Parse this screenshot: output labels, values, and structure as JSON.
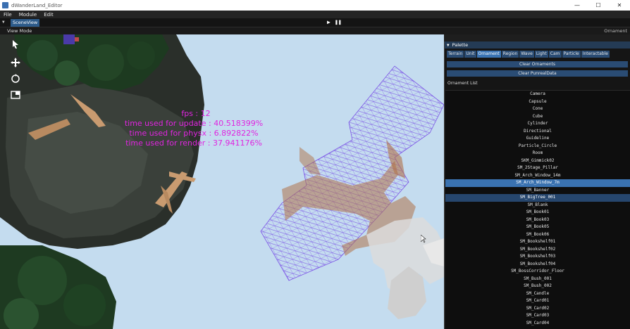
{
  "window": {
    "title": "dWanderLand_Editor",
    "minimize": "—",
    "maximize": "☐",
    "close": "✕"
  },
  "menu": [
    "File",
    "Module",
    "Edit"
  ],
  "toolbar": {
    "tab_label": "SceneView",
    "play_glyph": "▶",
    "pause_glyph": "❚❚"
  },
  "viewbar": {
    "view_mode": "View Mode",
    "right_label": "Ornament"
  },
  "stats": {
    "fps": "fps : 12",
    "update": "time used for update : 40.518399%",
    "physx": "time used for physx : 6.892822%",
    "render": "time used for render : 37.941176%"
  },
  "palette": {
    "title": "Palette",
    "tabs": [
      "Terrain",
      "Unit",
      "Ornament",
      "Region",
      "Wave",
      "Light",
      "Cam",
      "Particle",
      "Interactable"
    ],
    "active_tab": "Ornament",
    "clear_ornaments": "Clear Ornaments",
    "clear_puneal": "Clear PunrealData",
    "list_title": "Ornament List",
    "items": [
      "Camera",
      "Capsule",
      "Cone",
      "Cube",
      "Cylinder",
      "Directional",
      "Guideline",
      "Particle_Circle",
      "Room",
      "SKM_Gimmick02",
      "SM_2Stage_Pillar",
      "SM_Arch_Window_14m",
      "SM_Arch_Window_7m",
      "SM_Banner",
      "SM_BigTree_001",
      "SM_Blank",
      "SM_Book01",
      "SM_Book03",
      "SM_Book05",
      "SM_Book06",
      "SM_Bookshelf01",
      "SM_Bookshelf02",
      "SM_Bookshelf03",
      "SM_Bookshelf04",
      "SM_BossCorridor_Floor",
      "SM_Bush_001",
      "SM_Bush_002",
      "SM_Candle",
      "SM_Card01",
      "SM_Card02",
      "SM_Card03",
      "SM_Card04"
    ],
    "selected_item": "SM_Arch_Window_7m",
    "hover_item": "SM_BigTree_001"
  },
  "colors": {
    "sky": "#c4dcef",
    "stats_text": "#e025e0",
    "wireframe": "#7b52e6",
    "accent": "#3a72b0"
  },
  "icons": {
    "move": "move-icon",
    "rotate": "rotate-icon",
    "scale": "scale-icon"
  }
}
